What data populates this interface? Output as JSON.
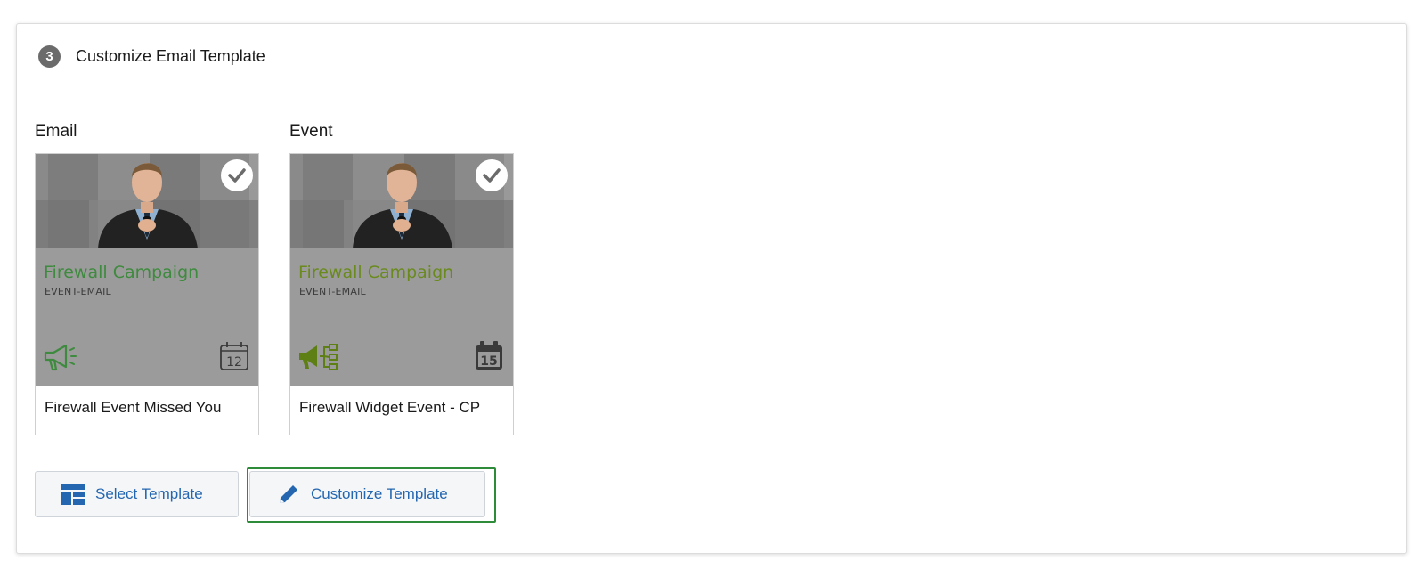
{
  "step": {
    "number": "3",
    "title": "Customize Email Template"
  },
  "columns": [
    {
      "label": "Email",
      "card": {
        "campaign_title": "Firewall Campaign",
        "campaign_subtitle": "EVENT-EMAIL",
        "template_name": "Firewall Event Missed You",
        "calendar_day": "12",
        "title_color": "#3e8a3e",
        "left_icon": "megaphone-outline-icon",
        "right_icon": "calendar-outline-icon",
        "selected": true
      }
    },
    {
      "label": "Event",
      "card": {
        "campaign_title": "Firewall Campaign",
        "campaign_subtitle": "EVENT-EMAIL",
        "template_name": "Firewall Widget Event - CP",
        "calendar_day": "15",
        "title_color": "#6a8a1e",
        "left_icon": "megaphone-network-icon",
        "right_icon": "calendar-solid-icon",
        "selected": true
      }
    }
  ],
  "buttons": {
    "select_template": "Select Template",
    "customize_template": "Customize Template"
  },
  "colors": {
    "accent_blue": "#2466b0",
    "focus_green": "#2e8b3a"
  }
}
